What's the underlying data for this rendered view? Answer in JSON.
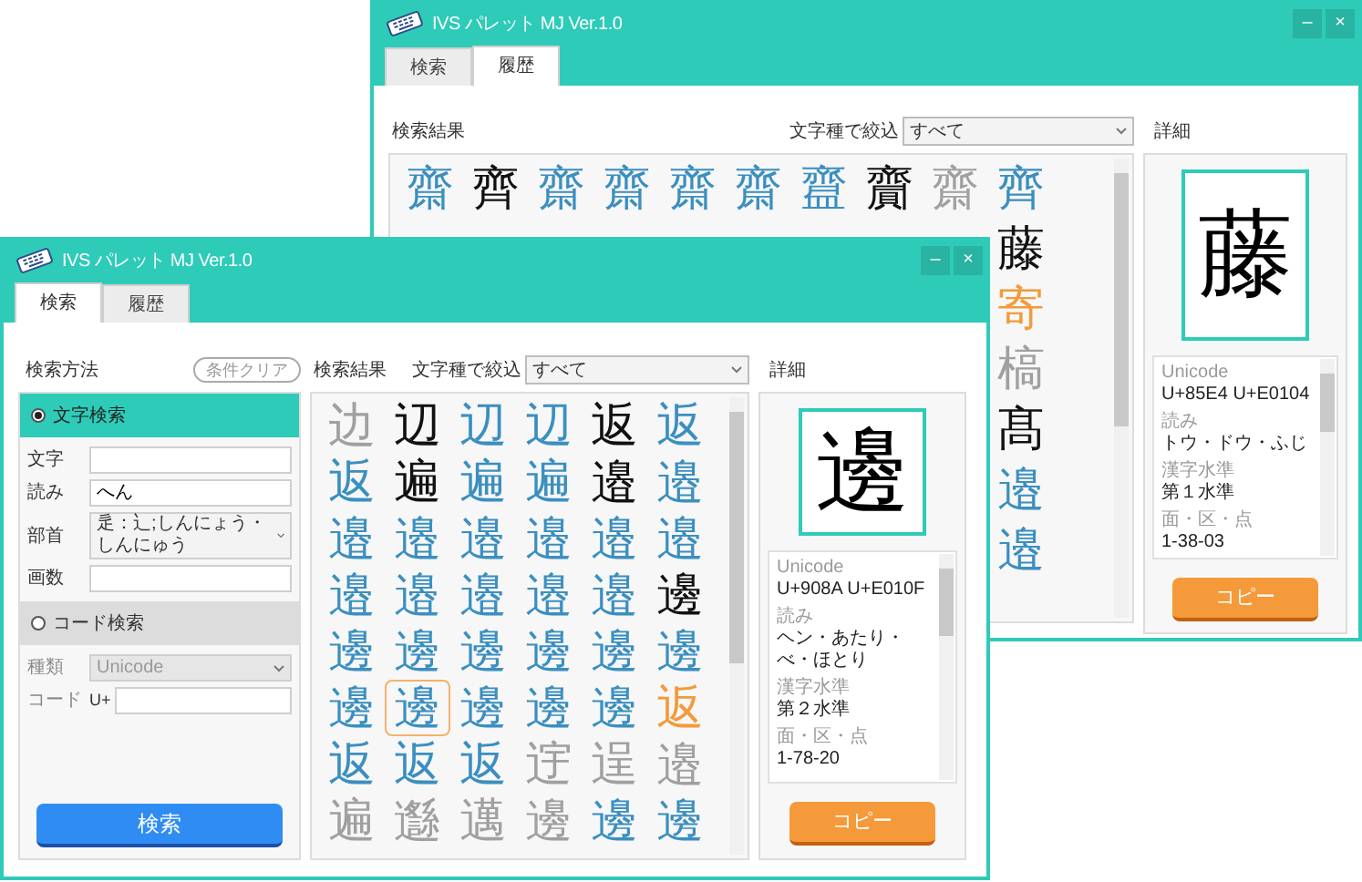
{
  "windows": [
    {
      "title": "IVS パレット MJ Ver.1.0",
      "window_buttons": [
        "–",
        "×"
      ],
      "tabs": [
        {
          "label": "検索",
          "selected": false
        },
        {
          "label": "履歴",
          "selected": true
        }
      ],
      "results_label": "検索結果",
      "filter": {
        "label": "文字種で絞込",
        "value": "すべて"
      },
      "detail_label": "詳細",
      "results": [
        [
          {
            "char": "齋",
            "color": "#3b8fc0",
            "selected": false
          },
          {
            "char": "齊",
            "color": "#111111",
            "selected": false
          },
          {
            "char": "齋",
            "color": "#3b8fc0",
            "selected": false
          },
          {
            "char": "齋",
            "color": "#3b8fc0",
            "selected": false
          },
          {
            "char": "齋",
            "color": "#3b8fc0",
            "selected": false
          },
          {
            "char": "齋",
            "color": "#3b8fc0",
            "selected": false
          },
          {
            "char": "齍",
            "color": "#3b8fc0",
            "selected": false
          },
          {
            "char": "齎",
            "color": "#111111",
            "selected": false
          },
          {
            "char": "齋",
            "color": "#a0a0a0",
            "selected": false
          },
          {
            "char": "齊",
            "color": "#3b8fc0",
            "selected": false
          }
        ],
        [
          {
            "char": "藤",
            "color": "#111111",
            "selected": false
          }
        ],
        [
          {
            "char": "寄",
            "color": "#f39a3b",
            "selected": false
          }
        ],
        [
          {
            "char": "槁",
            "color": "#a0a0a0",
            "selected": false
          }
        ],
        [
          {
            "char": "髙",
            "color": "#111111",
            "selected": false
          }
        ],
        [
          {
            "char": "邉",
            "color": "#3b8fc0",
            "selected": false
          }
        ],
        [
          {
            "char": "邉",
            "color": "#3b8fc0",
            "selected": false
          }
        ]
      ],
      "detail": {
        "glyph": "藤",
        "fields": [
          {
            "label": "Unicode",
            "value": "U+85E4 U+E0104"
          },
          {
            "label": "読み",
            "value": "トウ・ドウ・ふじ"
          },
          {
            "label": "漢字水準",
            "value": "第１水準"
          },
          {
            "label": "面・区・点",
            "value": "1-38-03"
          }
        ],
        "copy_button": "コピー"
      }
    },
    {
      "title": "IVS パレット MJ Ver.1.0",
      "window_buttons": [
        "–",
        "×"
      ],
      "tabs": [
        {
          "label": "検索",
          "selected": true
        },
        {
          "label": "履歴",
          "selected": false
        }
      ],
      "search_panel": {
        "label": "検索方法",
        "clear_button": "条件クリア",
        "sections": [
          {
            "title": "文字検索",
            "selected": true,
            "fields": [
              {
                "label": "文字",
                "kind": "text"
              },
              {
                "label": "読み",
                "kind": "text",
                "value": "へん"
              },
              {
                "label": "部首",
                "kind": "select",
                "value": "辵：⻌;しんにょう・しんにゅう"
              },
              {
                "label": "画数",
                "kind": "text"
              }
            ]
          },
          {
            "title": "コード検索",
            "selected": false,
            "fields": [
              {
                "label": "種類",
                "kind": "select",
                "value": "Unicode",
                "disabled": true
              },
              {
                "label": "コード",
                "kind": "text",
                "prefix": "U+"
              }
            ]
          }
        ],
        "search_button": "検索"
      },
      "results_label": "検索結果",
      "filter": {
        "label": "文字種で絞込",
        "value": "すべて"
      },
      "detail_label": "詳細",
      "results": [
        [
          {
            "char": "边",
            "color": "#a0a0a0",
            "selected": false
          },
          {
            "char": "辺",
            "color": "#111111",
            "selected": false
          },
          {
            "char": "辺",
            "color": "#3b8fc0",
            "selected": false
          },
          {
            "char": "辺",
            "color": "#3b8fc0",
            "selected": false
          },
          {
            "char": "返",
            "color": "#111111",
            "selected": false
          },
          {
            "char": "返",
            "color": "#3b8fc0",
            "selected": false
          }
        ],
        [
          {
            "char": "返",
            "color": "#3b8fc0",
            "selected": false
          },
          {
            "char": "遍",
            "color": "#111111",
            "selected": false
          },
          {
            "char": "遍",
            "color": "#3b8fc0",
            "selected": false
          },
          {
            "char": "遍",
            "color": "#3b8fc0",
            "selected": false
          },
          {
            "char": "邉",
            "color": "#111111",
            "selected": false
          },
          {
            "char": "邉",
            "color": "#3b8fc0",
            "selected": false
          }
        ],
        [
          {
            "char": "邉",
            "color": "#3b8fc0",
            "selected": false
          },
          {
            "char": "邉",
            "color": "#3b8fc0",
            "selected": false
          },
          {
            "char": "邉",
            "color": "#3b8fc0",
            "selected": false
          },
          {
            "char": "邉",
            "color": "#3b8fc0",
            "selected": false
          },
          {
            "char": "邉",
            "color": "#3b8fc0",
            "selected": false
          },
          {
            "char": "邉",
            "color": "#3b8fc0",
            "selected": false
          }
        ],
        [
          {
            "char": "邉",
            "color": "#3b8fc0",
            "selected": false
          },
          {
            "char": "邉",
            "color": "#3b8fc0",
            "selected": false
          },
          {
            "char": "邉",
            "color": "#3b8fc0",
            "selected": false
          },
          {
            "char": "邉",
            "color": "#3b8fc0",
            "selected": false
          },
          {
            "char": "邉",
            "color": "#3b8fc0",
            "selected": false
          },
          {
            "char": "邊",
            "color": "#111111",
            "selected": false
          }
        ],
        [
          {
            "char": "邊",
            "color": "#3b8fc0",
            "selected": false
          },
          {
            "char": "邊",
            "color": "#3b8fc0",
            "selected": false
          },
          {
            "char": "邊",
            "color": "#3b8fc0",
            "selected": false
          },
          {
            "char": "邊",
            "color": "#3b8fc0",
            "selected": false
          },
          {
            "char": "邊",
            "color": "#3b8fc0",
            "selected": false
          },
          {
            "char": "邊",
            "color": "#3b8fc0",
            "selected": false
          }
        ],
        [
          {
            "char": "邊",
            "color": "#3b8fc0",
            "selected": false
          },
          {
            "char": "邊",
            "color": "#3b8fc0",
            "selected": true
          },
          {
            "char": "邊",
            "color": "#3b8fc0",
            "selected": false
          },
          {
            "char": "邊",
            "color": "#3b8fc0",
            "selected": false
          },
          {
            "char": "邊",
            "color": "#3b8fc0",
            "selected": false
          },
          {
            "char": "返",
            "color": "#f39a3b",
            "selected": false
          }
        ],
        [
          {
            "char": "返",
            "color": "#3b8fc0",
            "selected": false
          },
          {
            "char": "返",
            "color": "#3b8fc0",
            "selected": false
          },
          {
            "char": "返",
            "color": "#3b8fc0",
            "selected": false
          },
          {
            "char": "䢓",
            "color": "#a0a0a0",
            "selected": false
          },
          {
            "char": "逞",
            "color": "#a0a0a0",
            "selected": false
          },
          {
            "char": "邉",
            "color": "#a0a0a0",
            "selected": false
          }
        ],
        [
          {
            "char": "遍",
            "color": "#a0a0a0",
            "selected": false
          },
          {
            "char": "邎",
            "color": "#a0a0a0",
            "selected": false
          },
          {
            "char": "邁",
            "color": "#a0a0a0",
            "selected": false
          },
          {
            "char": "邊",
            "color": "#a0a0a0",
            "selected": false
          },
          {
            "char": "邊",
            "color": "#3b8fc0",
            "selected": false
          },
          {
            "char": "邊",
            "color": "#3b8fc0",
            "selected": false
          }
        ]
      ],
      "detail": {
        "glyph": "邊",
        "fields": [
          {
            "label": "Unicode",
            "value": "U+908A U+E010F"
          },
          {
            "label": "読み",
            "value": "ヘン・あたり・べ・ほとり"
          },
          {
            "label": "漢字水準",
            "value": "第２水準"
          },
          {
            "label": "面・区・点",
            "value": "1-78-20"
          }
        ],
        "copy_button": "コピー"
      }
    }
  ]
}
